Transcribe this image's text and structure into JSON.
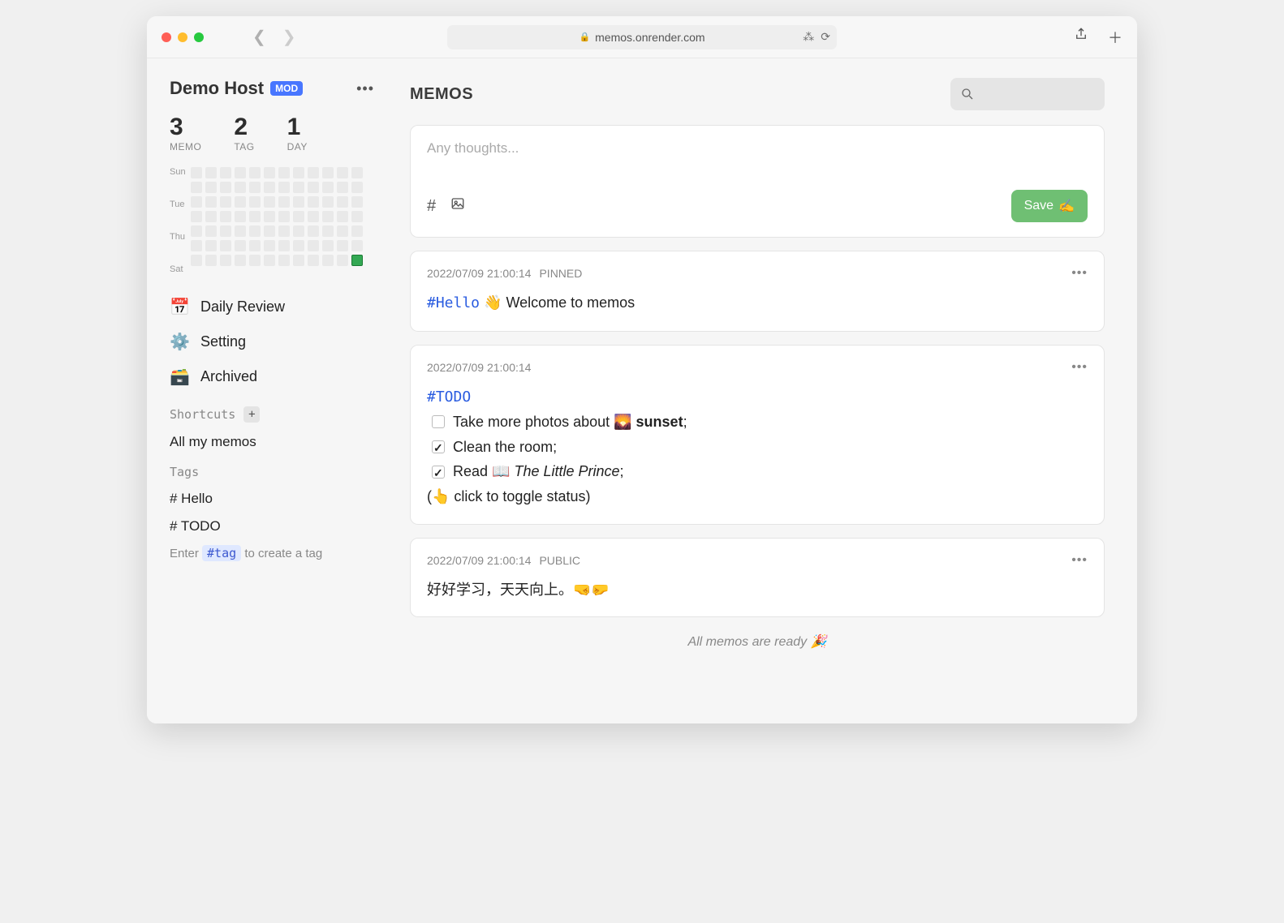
{
  "browser": {
    "url": "memos.onrender.com"
  },
  "user": {
    "name": "Demo Host",
    "badge": "MOD"
  },
  "stats": [
    {
      "value": "3",
      "label": "MEMO"
    },
    {
      "value": "2",
      "label": "TAG"
    },
    {
      "value": "1",
      "label": "DAY"
    }
  ],
  "heatmap": {
    "days": [
      "Sun",
      "",
      "Tue",
      "",
      "Thu",
      "",
      "Sat"
    ]
  },
  "nav": [
    {
      "icon": "📅",
      "label": "Daily Review"
    },
    {
      "icon": "⚙️",
      "label": "Setting"
    },
    {
      "icon": "🗃️",
      "label": "Archived"
    }
  ],
  "shortcuts": {
    "title": "Shortcuts",
    "items": [
      "All my memos"
    ]
  },
  "tags": {
    "title": "Tags",
    "items": [
      "# Hello",
      "# TODO"
    ],
    "hint_before": "Enter ",
    "hint_chip": "#tag",
    "hint_after": " to create a tag"
  },
  "main": {
    "title": "MEMOS",
    "editor": {
      "placeholder": "Any thoughts...",
      "save_label": "Save",
      "save_emoji": "✍️"
    },
    "memos": [
      {
        "ts": "2022/07/09 21:00:14",
        "badge": "PINNED",
        "tag": "#Hello",
        "body_text": " 👋 Welcome to memos"
      },
      {
        "ts": "2022/07/09 21:00:14",
        "badge": "",
        "tag": "#TODO",
        "todos": [
          {
            "done": false,
            "html": "Take more photos about 🌄 <b>sunset</b>;"
          },
          {
            "done": true,
            "html": "Clean the room;"
          },
          {
            "done": true,
            "html": "Read 📖 <i>The Little Prince</i>;"
          }
        ],
        "note": "(👆 click to toggle status)"
      },
      {
        "ts": "2022/07/09 21:00:14",
        "badge": "PUBLIC",
        "body_text": "好好学习，天天向上。🤜🤛"
      }
    ],
    "footer": "All memos are ready 🎉"
  }
}
